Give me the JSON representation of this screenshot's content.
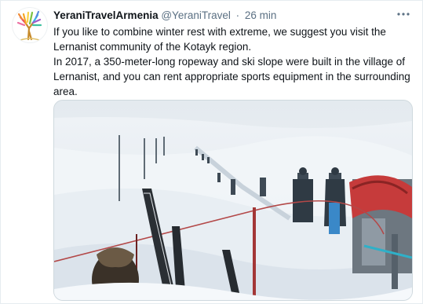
{
  "tweet": {
    "display_name": "YeraniTravelArmenia",
    "handle": "@YeraniTravel",
    "separator": "·",
    "timestamp": "26 min",
    "more_icon": "more-dots-icon",
    "paragraphs": [
      "If you like to combine winter rest with extreme, we suggest you visit the Lernanist community of the Kotayk region.",
      "In 2017, a 350-meter-long ropeway and ski slope were built in the village of Lernanist, and you can rent appropriate sports equipment in the surrounding area."
    ]
  },
  "avatar": {
    "icon": "tree-logo-icon",
    "colors": [
      "#e8505b",
      "#f6a623",
      "#f8d247",
      "#7ac143",
      "#38b6e8",
      "#a05cc8"
    ]
  },
  "media": {
    "icon": "photo-ski-slope",
    "colors": {
      "sky": "#e9eef2",
      "snow": "#f4f7fa",
      "shadow": "#c9d4de",
      "lift": "#c63b3b",
      "pole": "#5f6b75"
    }
  }
}
